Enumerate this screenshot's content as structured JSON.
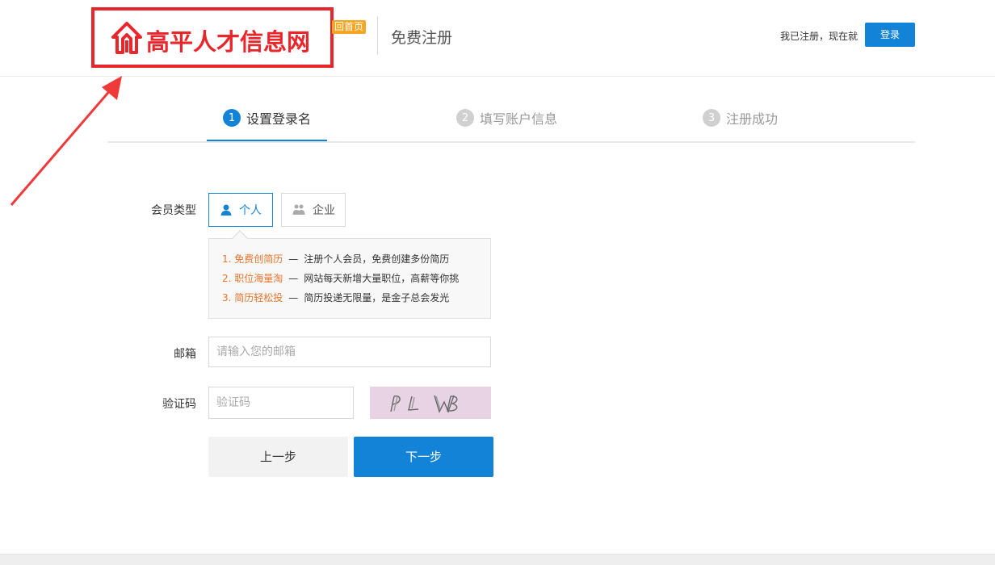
{
  "header": {
    "logo_text": "高平人才信息网",
    "home_badge": "回首页",
    "page_title": "免费注册",
    "login_hint": "我已注册，现在就",
    "login_button": "登录"
  },
  "steps": [
    {
      "num": "1",
      "label": "设置登录名"
    },
    {
      "num": "2",
      "label": "填写账户信息"
    },
    {
      "num": "3",
      "label": "注册成功"
    }
  ],
  "form": {
    "member_type_label": "会员类型",
    "type_personal": "个人",
    "type_company": "企业",
    "benefits": [
      {
        "title": "1. 免费创简历",
        "dash": "—",
        "desc": "注册个人会员，免费创建多份简历"
      },
      {
        "title": "2. 职位海量淘",
        "dash": "—",
        "desc": "网站每天新增大量职位，高薪等你挑"
      },
      {
        "title": "3. 简历轻松投",
        "dash": "—",
        "desc": "简历投递无限量，是金子总会发光"
      }
    ],
    "email_label": "邮箱",
    "email_placeholder": "请输入您的邮箱",
    "captcha_label": "验证码",
    "captcha_placeholder": "验证码",
    "captcha_text": "pL WB",
    "prev_button": "上一步",
    "next_button": "下一步"
  },
  "colors": {
    "brand_red": "#e8272c",
    "primary_blue": "#1283d6",
    "badge_orange": "#f5a623",
    "highlight_orange": "#e8742a"
  },
  "icons": {
    "logo": "logo-house-icon",
    "personal": "person-icon",
    "company": "company-icon",
    "annotation": "red-arrow-icon"
  }
}
